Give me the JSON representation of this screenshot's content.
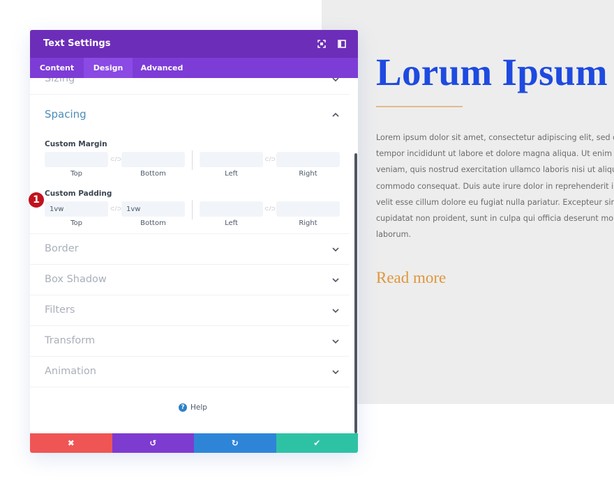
{
  "modal": {
    "title": "Text Settings",
    "header_icons": [
      "fullscreen-icon",
      "split-view-icon"
    ],
    "tabs": [
      {
        "label": "Content",
        "active": false
      },
      {
        "label": "Design",
        "active": true
      },
      {
        "label": "Advanced",
        "active": false
      }
    ],
    "sections": {
      "sizing": "Sizing",
      "spacing": "Spacing",
      "border": "Border",
      "box_shadow": "Box Shadow",
      "filters": "Filters",
      "transform": "Transform",
      "animation": "Animation"
    },
    "custom_margin": {
      "label": "Custom Margin",
      "top": "",
      "bottom": "",
      "left": "",
      "right": "",
      "labels": {
        "top": "Top",
        "bottom": "Bottom",
        "left": "Left",
        "right": "Right"
      }
    },
    "custom_padding": {
      "label": "Custom Padding",
      "top": "1vw",
      "bottom": "1vw",
      "left": "",
      "right": "",
      "labels": {
        "top": "Top",
        "bottom": "Bottom",
        "left": "Left",
        "right": "Right"
      }
    },
    "link_glyph": "⊂/⊃",
    "annotation_badge": "1",
    "help_label": "Help",
    "footer": {
      "discard_icon": "✖",
      "undo_icon": "↺",
      "redo_icon": "↻",
      "save_icon": "✔"
    },
    "colors": {
      "header": "#6c2eb9",
      "tabs": "#7d3cd6",
      "discard": "#ef5555",
      "undo": "#7e3bd0",
      "redo": "#2e85d8",
      "save": "#2ec2a5"
    }
  },
  "preview": {
    "title": "Lorum Ipsum Dolor",
    "body_lines": [
      "Lorem ipsum dolor sit amet, consectetur adipiscing elit, sed do eiusmod",
      "tempor incididunt ut labore et dolore magna aliqua. Ut enim ad minim",
      "veniam, quis nostrud exercitation ullamco laboris nisi ut aliquip ex ea",
      "commodo consequat. Duis aute irure dolor in reprehenderit in voluptate",
      "velit esse cillum dolore eu fugiat nulla pariatur. Excepteur sint occaecat",
      "cupidatat non proident, sunt in culpa qui officia deserunt mollit anim id est",
      "laborum."
    ],
    "link": "Read more",
    "colors": {
      "title": "#1e4ae0",
      "link": "#e0963a",
      "divider": "#e2b98c"
    }
  }
}
